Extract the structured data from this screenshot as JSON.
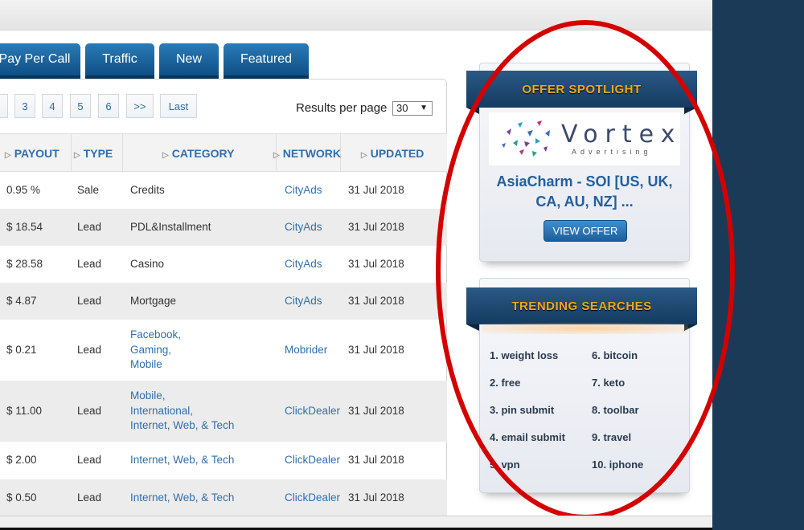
{
  "tabs": [
    {
      "label": "Pay Per Call"
    },
    {
      "label": "Traffic"
    },
    {
      "label": "New"
    },
    {
      "label": "Featured"
    }
  ],
  "pager": {
    "pages": [
      "3",
      "4",
      "5",
      "6",
      ">>",
      "Last"
    ],
    "results_label": "Results per page",
    "results_value": "30"
  },
  "table": {
    "columns": [
      "PAYOUT",
      "TYPE",
      "CATEGORY",
      "NETWORK",
      "UPDATED"
    ],
    "rows": [
      {
        "payout": "0.95 %",
        "type": "Sale",
        "category": [
          "Credits"
        ],
        "category_link": false,
        "network": "CityAds",
        "updated": "31 Jul 2018"
      },
      {
        "payout": "$ 18.54",
        "type": "Lead",
        "category": [
          "PDL&Installment"
        ],
        "category_link": false,
        "network": "CityAds",
        "updated": "31 Jul 2018"
      },
      {
        "payout": "$ 28.58",
        "type": "Lead",
        "category": [
          "Casino"
        ],
        "category_link": false,
        "network": "CityAds",
        "updated": "31 Jul 2018"
      },
      {
        "payout": "$ 4.87",
        "type": "Lead",
        "category": [
          "Mortgage"
        ],
        "category_link": false,
        "network": "CityAds",
        "updated": "31 Jul 2018"
      },
      {
        "payout": "$ 0.21",
        "type": "Lead",
        "category": [
          "Facebook,",
          "Gaming,",
          "Mobile"
        ],
        "category_link": true,
        "network": "Mobrider",
        "updated": "31 Jul 2018"
      },
      {
        "payout": "$ 11.00",
        "type": "Lead",
        "category": [
          "Mobile,",
          "International,",
          "Internet, Web, & Tech"
        ],
        "category_link": true,
        "network": "ClickDealer",
        "updated": "31 Jul 2018"
      },
      {
        "payout": "$ 2.00",
        "type": "Lead",
        "category": [
          "Internet, Web, & Tech"
        ],
        "category_link": true,
        "network": "ClickDealer",
        "updated": "31 Jul 2018"
      },
      {
        "payout": "$ 0.50",
        "type": "Lead",
        "category": [
          "Internet, Web, & Tech"
        ],
        "category_link": true,
        "network": "ClickDealer",
        "updated": "31 Jul 2018"
      }
    ]
  },
  "spotlight": {
    "heading": "OFFER SPOTLIGHT",
    "logo_text": "Vortex",
    "logo_sub": "Advertising",
    "offer_title": "AsiaCharm - SOI [US, UK, CA, AU, NZ] ...",
    "button_label": "VIEW OFFER"
  },
  "trending": {
    "heading": "TRENDING SEARCHES",
    "items": [
      "1.  weight loss",
      "2.  free",
      "3.  pin submit",
      "4.  email submit",
      "5.  vpn",
      "6.  bitcoin",
      "7.  keto",
      "8.  toolbar",
      "9.  travel",
      "10.  iphone"
    ]
  },
  "colors": {
    "tab_blue": "#1a63a0",
    "link_blue": "#2f6fae",
    "ribbon_gold": "#f2a818",
    "annotation_red": "#d40000"
  }
}
